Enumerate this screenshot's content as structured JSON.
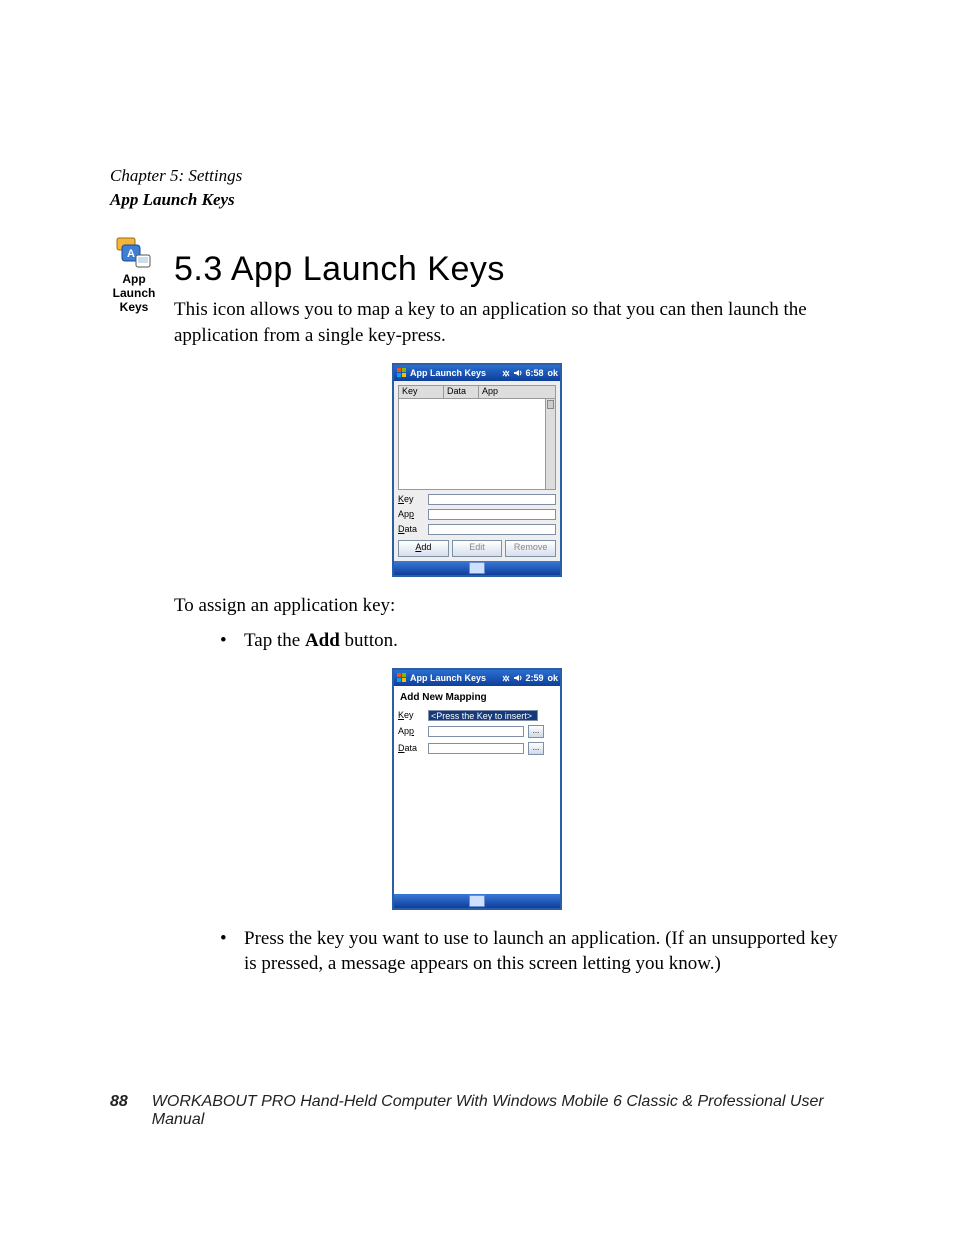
{
  "header": {
    "chapter_line": "Chapter 5: Settings",
    "section_line": "App Launch Keys"
  },
  "icon_caption": "App Launch Keys",
  "heading": "5.3  App Launch Keys",
  "intro": "This icon allows you to map a key to an application so that you can then launch the application from a single key-press.",
  "instruction": "To assign an application key:",
  "bullet1_pre": "Tap the ",
  "bullet1_bold": "Add",
  "bullet1_post": " button.",
  "bullet2": "Press the key you want to use to launch an application. (If an unsupported key is pressed, a message appears on this screen letting you know.)",
  "footer": {
    "page_number": "88",
    "book_title": "WORKABOUT PRO Hand-Held Computer With Windows Mobile 6 Classic & Professional User Manual"
  },
  "screenshot1": {
    "title": "App Launch Keys",
    "time": "6:58",
    "ok": "ok",
    "cols": {
      "key": "Key",
      "data": "Data",
      "app": "App"
    },
    "labels": {
      "key": "Key",
      "app": "App",
      "data": "Data"
    },
    "underlines": {
      "key": "K",
      "app": "p",
      "data": "D"
    },
    "buttons": {
      "add": "Add",
      "edit": "Edit",
      "remove": "Remove"
    },
    "add_underline": "A"
  },
  "screenshot2": {
    "title": "App Launch Keys",
    "time": "2:59",
    "ok": "ok",
    "subtitle": "Add New Mapping",
    "labels": {
      "key": "Key",
      "app": "App",
      "data": "Data"
    },
    "underlines": {
      "key": "K",
      "app": "p",
      "data": "D"
    },
    "key_placeholder": "<Press the Key to insert>",
    "browse": "..."
  }
}
